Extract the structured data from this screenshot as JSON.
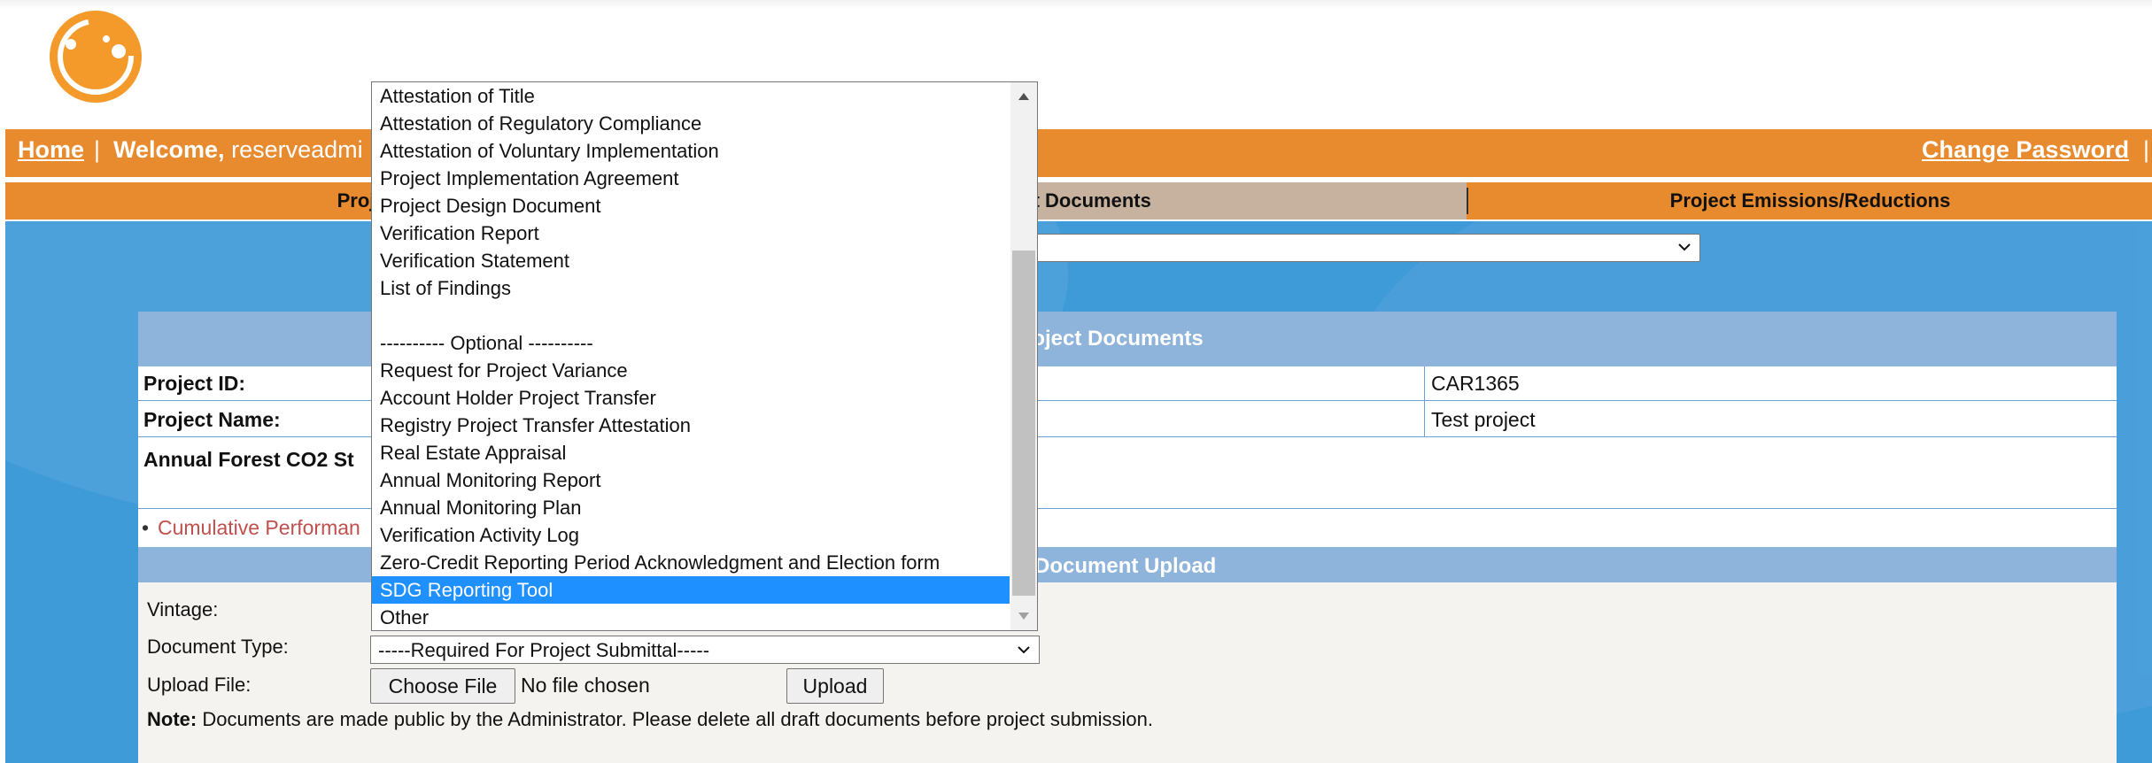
{
  "nav": {
    "home": "Home",
    "sep": "|",
    "welcome": "Welcome,",
    "user": "reserveadmi",
    "change_password": "Change Password"
  },
  "tabs": [
    {
      "label": "Project S"
    },
    {
      "label": "ject Documents"
    },
    {
      "label": "Project Emissions/Reductions"
    }
  ],
  "panel": {
    "header": "roject Documents",
    "project_id_label": "Project ID:",
    "project_id_value": "CAR1365",
    "project_name_label": "Project Name:",
    "project_name_value": "Test project",
    "annual_label": "Annual Forest CO2 St",
    "cumulative_link": "Cumulative Performan",
    "bullet": "•"
  },
  "upload": {
    "header": "Document Upload",
    "vintage_label": "Vintage:",
    "doctype_label": "Document Type:",
    "doctype_value": "-----Required For Project Submittal-----",
    "uploadfile_label": "Upload File:",
    "choose_file": "Choose File",
    "no_file": "No file chosen",
    "upload_btn": "Upload",
    "note_bold": "Note:",
    "note_text": " Documents are made public by the Administrator. Please delete all draft documents before project submission."
  },
  "dropdown": {
    "options": [
      "Attestation of Title",
      "Attestation of Regulatory Compliance",
      "Attestation of Voluntary Implementation",
      "Project Implementation Agreement",
      "Project Design Document",
      "Verification Report",
      "Verification Statement",
      "List of Findings",
      "",
      "---------- Optional ----------",
      "Request for Project Variance",
      "Account Holder Project Transfer",
      "Registry Project Transfer Attestation",
      "Real Estate Appraisal",
      "Annual Monitoring Report",
      "Annual Monitoring Plan",
      "Verification Activity Log",
      "Zero-Credit Reporting Period Acknowledgment and Election form",
      "SDG Reporting Tool",
      "Other"
    ],
    "selected": "SDG Reporting Tool"
  },
  "colors": {
    "nav_orange": "#e88a2e",
    "content_blue": "#3f9ad8",
    "panel_header": "#8fb4db",
    "selected": "#1e90ff",
    "link_red": "#c0504d"
  }
}
